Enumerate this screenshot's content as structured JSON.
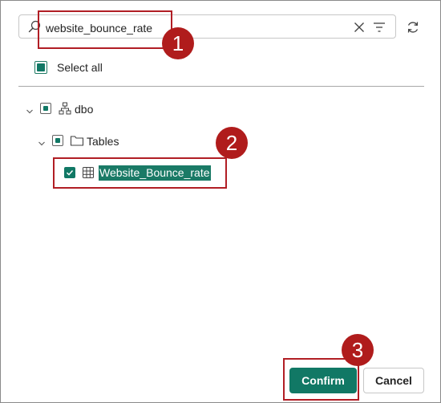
{
  "search": {
    "value": "website_bounce_rate",
    "icon": "search-icon",
    "clear_icon": "dismiss-icon",
    "filter_icon": "filter-icon",
    "refresh_icon": "refresh-icon"
  },
  "select_all": {
    "label": "Select all",
    "state": "partial"
  },
  "tree": {
    "schema": {
      "label": "dbo",
      "expanded": true,
      "state": "partial",
      "icon": "schema-icon"
    },
    "folder": {
      "label": "Tables",
      "expanded": true,
      "state": "partial",
      "icon": "folder-icon"
    },
    "table": {
      "label": "Website_Bounce_rate",
      "checked": true,
      "selected": true,
      "icon": "table-grid-icon"
    }
  },
  "annotations": {
    "step1": "1",
    "step2": "2",
    "step3": "3",
    "color": "#b01c1c"
  },
  "footer": {
    "confirm_label": "Confirm",
    "cancel_label": "Cancel"
  },
  "colors": {
    "accent": "#117865",
    "highlight_border": "#b11e25"
  }
}
